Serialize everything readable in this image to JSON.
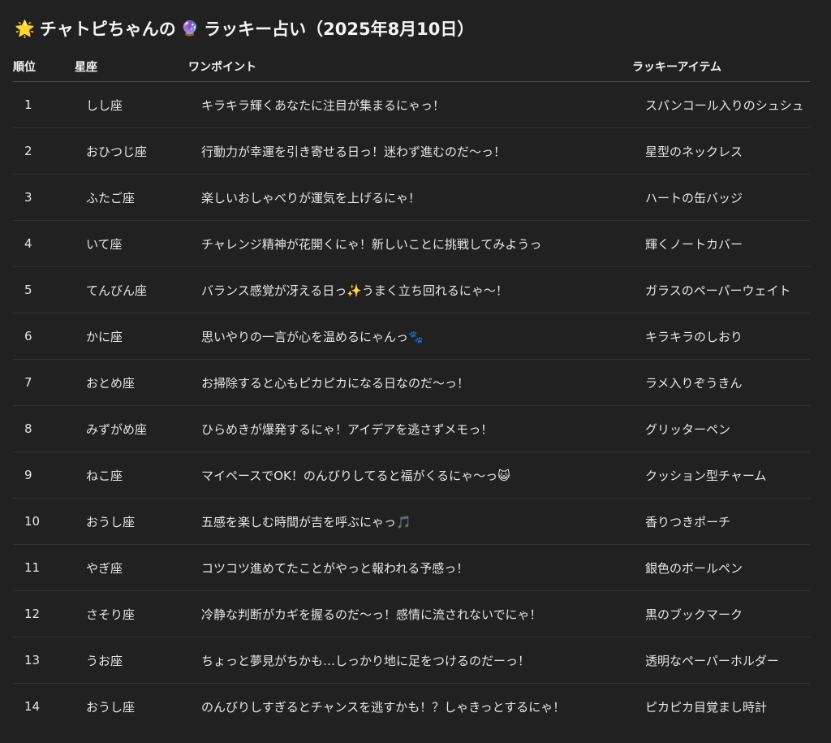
{
  "header": {
    "title_emoji": "🌟",
    "title_part1": "チャトピちゃんの",
    "title_emoji2": "🔮",
    "title_part2": "ラッキー占い（2025年8月10日）"
  },
  "table": {
    "columns": [
      "順位",
      "星座",
      "ワンポイント",
      "ラッキーアイテム"
    ],
    "rows": [
      {
        "rank": "1",
        "sign": "しし座",
        "tip": "キラキラ輝くあなたに注目が集まるにゃっ！",
        "item": "スパンコール入りのシュシュ"
      },
      {
        "rank": "2",
        "sign": "おひつじ座",
        "tip": "行動力が幸運を引き寄せる日っ！迷わず進むのだ〜っ！",
        "item": "星型のネックレス"
      },
      {
        "rank": "3",
        "sign": "ふたご座",
        "tip": "楽しいおしゃべりが運気を上げるにゃ！",
        "item": "ハートの缶バッジ"
      },
      {
        "rank": "4",
        "sign": "いて座",
        "tip": "チャレンジ精神が花開くにゃ！新しいことに挑戦してみようっ",
        "item": "輝くノートカバー"
      },
      {
        "rank": "5",
        "sign": "てんびん座",
        "tip": "バランス感覚が冴える日っ✨うまく立ち回れるにゃ〜！",
        "item": "ガラスのペーパーウェイト"
      },
      {
        "rank": "6",
        "sign": "かに座",
        "tip": "思いやりの一言が心を温めるにゃんっ🐾",
        "item": "キラキラのしおり"
      },
      {
        "rank": "7",
        "sign": "おとめ座",
        "tip": "お掃除すると心もピカピカになる日なのだ〜っ！",
        "item": "ラメ入りぞうきん"
      },
      {
        "rank": "8",
        "sign": "みずがめ座",
        "tip": "ひらめきが爆発するにゃ！アイデアを逃さずメモっ！",
        "item": "グリッターペン"
      },
      {
        "rank": "9",
        "sign": "ねこ座",
        "tip": "マイペースでOK！のんびりしてると福がくるにゃ〜っ😺",
        "item": "クッション型チャーム"
      },
      {
        "rank": "10",
        "sign": "おうし座",
        "tip": "五感を楽しむ時間が吉を呼ぶにゃっ🎵",
        "item": "香りつきポーチ"
      },
      {
        "rank": "11",
        "sign": "やぎ座",
        "tip": "コツコツ進めてたことがやっと報われる予感っ！",
        "item": "銀色のボールペン"
      },
      {
        "rank": "12",
        "sign": "さそり座",
        "tip": "冷静な判断がカギを握るのだ〜っ！感情に流されないでにゃ！",
        "item": "黒のブックマーク"
      },
      {
        "rank": "13",
        "sign": "うお座",
        "tip": "ちょっと夢見がちかも…しっかり地に足をつけるのだーっ！",
        "item": "透明なペーパーホルダー"
      },
      {
        "rank": "14",
        "sign": "おうし座",
        "tip": "のんびりしすぎるとチャンスを逃すかも！？しゃきっとするにゃ！",
        "item": "ピカピカ目覚まし時計"
      }
    ]
  }
}
